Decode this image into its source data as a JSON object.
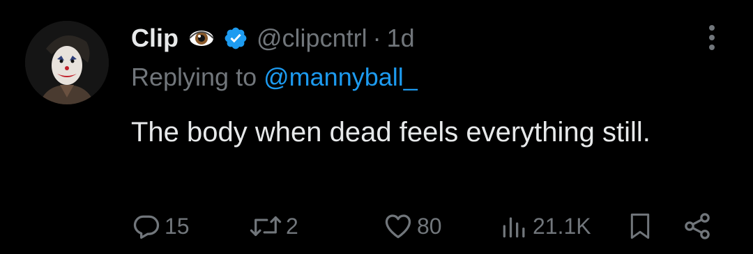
{
  "tweet": {
    "display_name": "Clip",
    "handle": "@clipcntrl",
    "separator": "·",
    "time": "1d",
    "replying_prefix": "Replying to",
    "replying_handle": "@mannyball_",
    "text": "The body when dead feels everything still."
  },
  "actions": {
    "replies": "15",
    "reposts": "2",
    "likes": "80",
    "views": "21.1K"
  },
  "icons": {
    "avatar": "avatar-joker-icon",
    "eye_emoji": "eye-emoji-icon",
    "verified": "verified-badge-icon",
    "more": "more-vertical-icon",
    "reply": "reply-icon",
    "repost": "repost-icon",
    "like": "heart-icon",
    "views": "views-chart-icon",
    "bookmark": "bookmark-icon",
    "share": "share-icon"
  },
  "colors": {
    "background": "#000000",
    "primary_text": "#e7e9ea",
    "secondary_text": "#71767b",
    "accent": "#1d9bf0"
  }
}
